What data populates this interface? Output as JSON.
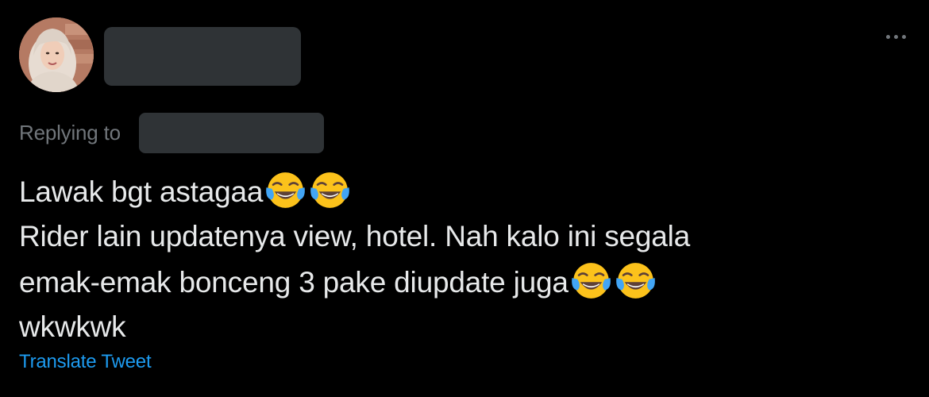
{
  "tweet": {
    "reply_prefix": "Replying to",
    "text_lines": [
      "Lawak bgt astagaa",
      "Rider lain updatenya view, hotel. Nah kalo ini segala",
      "emak-emak bonceng 3 pake diupdate juga",
      "wkwkwk"
    ],
    "emoji_name": "face-with-tears-of-joy-icon",
    "translate_label": "Translate Tweet",
    "more_icon": "more-options-icon"
  },
  "colors": {
    "background": "#000000",
    "text": "#e7e9ea",
    "secondary_text": "#71767b",
    "link": "#1d9bf0",
    "redaction": "#2f3336"
  }
}
